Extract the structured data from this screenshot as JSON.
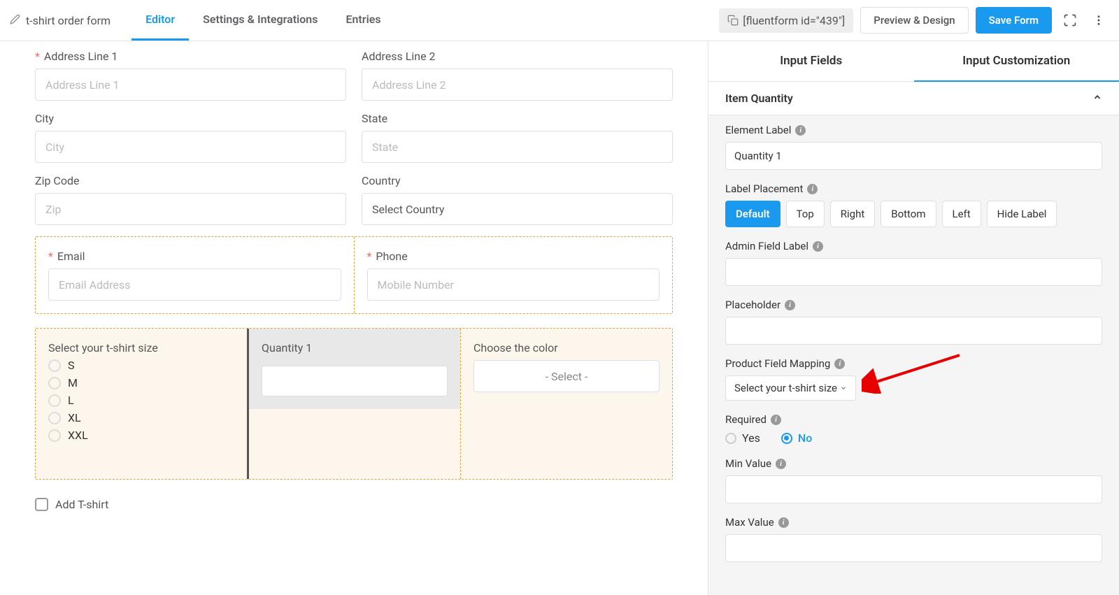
{
  "header": {
    "form_title": "t-shirt order form",
    "tabs": {
      "editor": "Editor",
      "settings": "Settings & Integrations",
      "entries": "Entries"
    },
    "shortcode": "[fluentform id=\"439\"]",
    "preview": "Preview & Design",
    "save": "Save Form"
  },
  "canvas": {
    "addr1_label": "Address Line 1",
    "addr1_ph": "Address Line 1",
    "addr2_label": "Address Line 2",
    "addr2_ph": "Address Line 2",
    "city_label": "City",
    "city_ph": "City",
    "state_label": "State",
    "state_ph": "State",
    "zip_label": "Zip Code",
    "zip_ph": "Zip",
    "country_label": "Country",
    "country_sel": "Select Country",
    "email_label": "Email",
    "email_ph": "Email Address",
    "phone_label": "Phone",
    "phone_ph": "Mobile Number",
    "size_label": "Select your t-shirt size",
    "sizes": {
      "s": "S",
      "m": "M",
      "l": "L",
      "xl": "XL",
      "xxl": "XXL"
    },
    "qty_label": "Quantity 1",
    "color_label": "Choose the color",
    "color_sel": "- Select -",
    "add_tshirt": "Add T-shirt"
  },
  "side": {
    "tab_fields": "Input Fields",
    "tab_custom": "Input Customization",
    "section": "Item Quantity",
    "elem_label": "Element Label",
    "elem_label_val": "Quantity 1",
    "label_placement": "Label Placement",
    "seg": {
      "def": "Default",
      "top": "Top",
      "right": "Right",
      "bottom": "Bottom",
      "left": "Left",
      "hide": "Hide Label"
    },
    "admin_label": "Admin Field Label",
    "placeholder": "Placeholder",
    "mapping": "Product Field Mapping",
    "mapping_val": "Select your t-shirt size",
    "required": "Required",
    "yes": "Yes",
    "no": "No",
    "min": "Min Value",
    "max": "Max Value"
  }
}
